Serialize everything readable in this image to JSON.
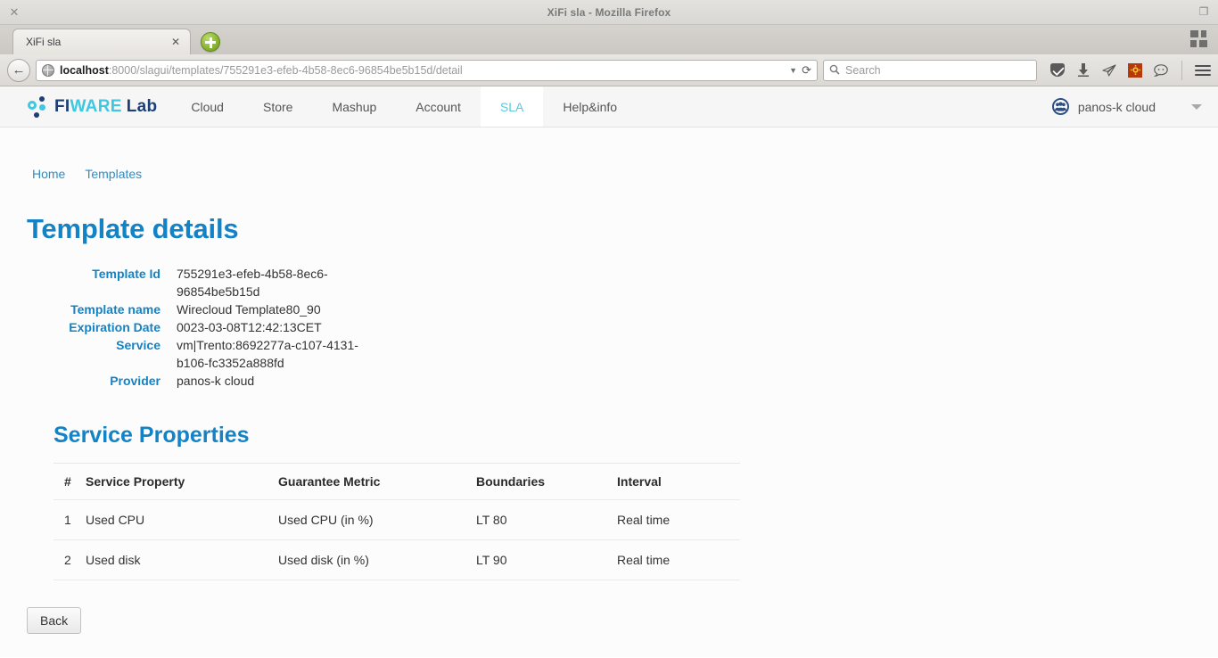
{
  "window": {
    "title": "XiFi sla - Mozilla Firefox",
    "close_glyph": "✕",
    "restore_glyph": "❐"
  },
  "browser": {
    "tab": {
      "label": "XiFi sla",
      "close_glyph": "✕"
    },
    "new_tab_label": "+",
    "back_glyph": "←",
    "url": {
      "host": "localhost",
      "rest": ":8000/slagui/templates/755291e3-efeb-4b58-8ec6-96854be5b15d/detail"
    },
    "url_dropdown_glyph": "▼",
    "reload_glyph": "⟳",
    "search": {
      "placeholder": "Search",
      "icon_glyph": "🔍"
    },
    "toolbar_icons": [
      {
        "name": "pocket-icon",
        "glyph": ""
      },
      {
        "name": "download-icon",
        "glyph": "⬇"
      },
      {
        "name": "send-tab-icon",
        "glyph": "➤"
      },
      {
        "name": "addon-orange-icon",
        "glyph": "☼"
      },
      {
        "name": "chat-icon",
        "glyph": "☻"
      },
      {
        "name": "menu-icon",
        "glyph": ""
      }
    ]
  },
  "navbar": {
    "brand": {
      "fi": "FI",
      "ware": "WARE",
      "lab": "Lab"
    },
    "items": [
      {
        "label": "Cloud",
        "active": false
      },
      {
        "label": "Store",
        "active": false
      },
      {
        "label": "Mashup",
        "active": false
      },
      {
        "label": "Account",
        "active": false
      },
      {
        "label": "SLA",
        "active": true
      },
      {
        "label": "Help&info",
        "active": false
      }
    ],
    "user": {
      "name": "panos-k cloud",
      "avatar_glyph": "👥",
      "caret": "▾"
    }
  },
  "breadcrumb": [
    {
      "label": "Home"
    },
    {
      "label": "Templates"
    }
  ],
  "main": {
    "page_title": "Template details",
    "details": [
      {
        "label": "Template Id",
        "value": "755291e3-efeb-4b58-8ec6-96854be5b15d"
      },
      {
        "label": "Template name",
        "value": "Wirecloud Template80_90"
      },
      {
        "label": "Expiration Date",
        "value": "0023-03-08T12:42:13CET"
      },
      {
        "label": "Service",
        "value": "vm|Trento:8692277a-c107-4131-b106-fc3352a888fd"
      },
      {
        "label": "Provider",
        "value": "panos-k cloud"
      }
    ],
    "section_title": "Service Properties",
    "table": {
      "headers": [
        "#",
        "Service Property",
        "Guarantee Metric",
        "Boundaries",
        "Interval"
      ],
      "rows": [
        {
          "num": "1",
          "property": "Used CPU",
          "metric": "Used CPU (in %)",
          "boundaries": "LT 80",
          "interval": "Real time"
        },
        {
          "num": "2",
          "property": "Used disk",
          "metric": "Used disk (in %)",
          "boundaries": "LT 90",
          "interval": "Real time"
        }
      ]
    },
    "back_label": "Back"
  },
  "colors": {
    "accent_blue": "#1383c6",
    "link_blue": "#2a8fc9",
    "brand_cyan": "#3ec7e0",
    "brand_navy": "#1b3f76",
    "active_tab_text": "#5bc8e0"
  }
}
